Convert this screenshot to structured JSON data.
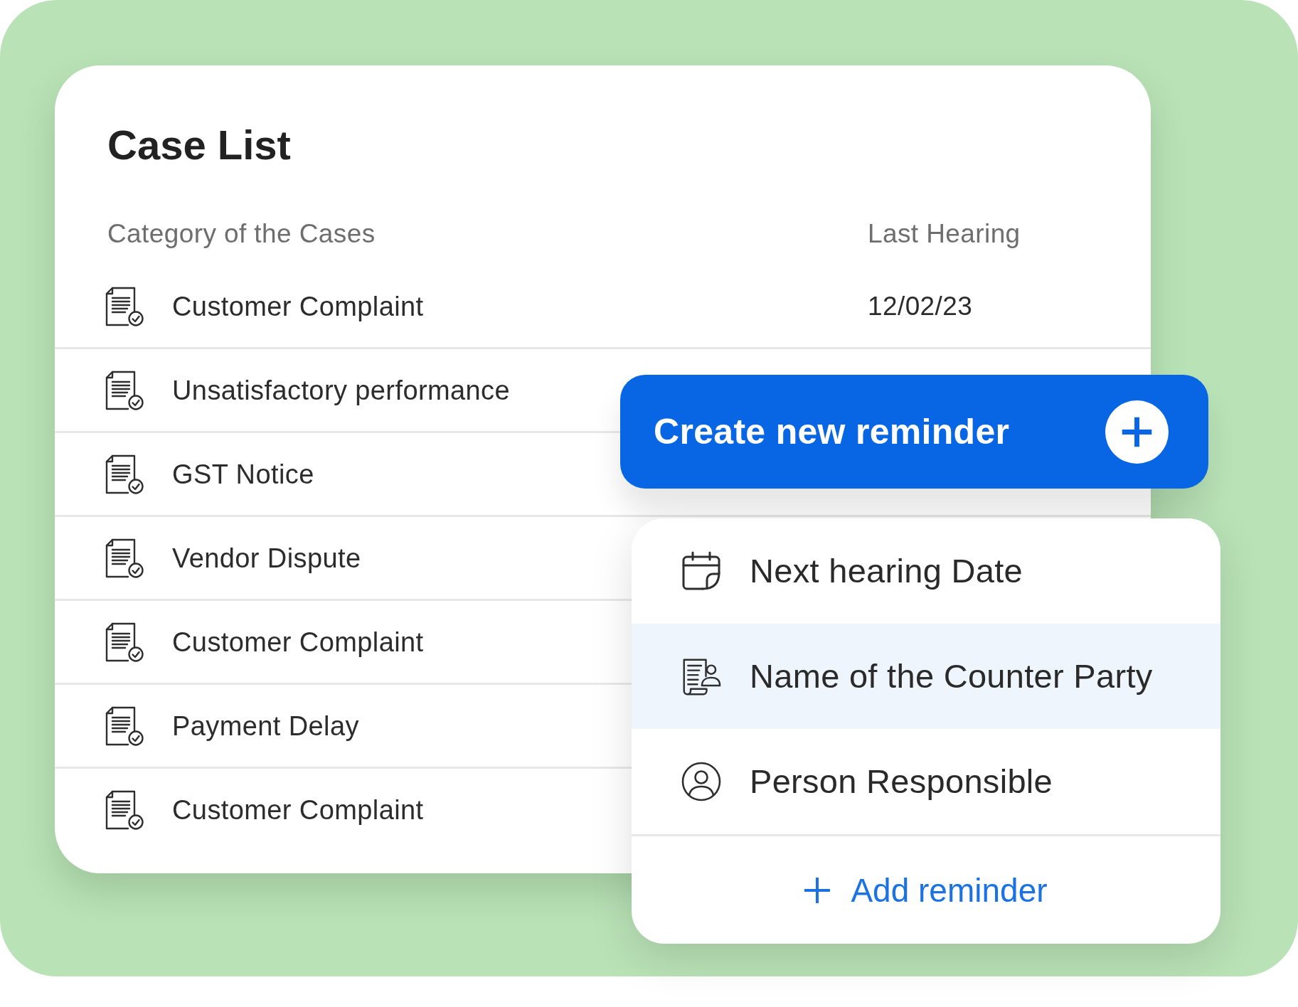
{
  "case_list": {
    "title": "Case List",
    "columns": [
      "Category of the Cases",
      "Last Hearing"
    ],
    "rows": [
      {
        "category": "Customer Complaint",
        "last_hearing": "12/02/23"
      },
      {
        "category": "Unsatisfactory performance"
      },
      {
        "category": "GST Notice"
      },
      {
        "category": "Vendor Dispute"
      },
      {
        "category": "Customer Complaint"
      },
      {
        "category": "Payment Delay"
      },
      {
        "category": "Customer Complaint"
      }
    ]
  },
  "reminder_menu": {
    "create_button": {
      "label": "Create new reminder"
    },
    "items": [
      {
        "label": "Next hearing Date",
        "kind": "calendar",
        "selected": false
      },
      {
        "label": "Name of the Counter Party",
        "kind": "party",
        "selected": true
      },
      {
        "label": "Person Responsible",
        "kind": "person",
        "selected": false
      }
    ],
    "add_button": {
      "label": "Add reminder"
    }
  }
}
